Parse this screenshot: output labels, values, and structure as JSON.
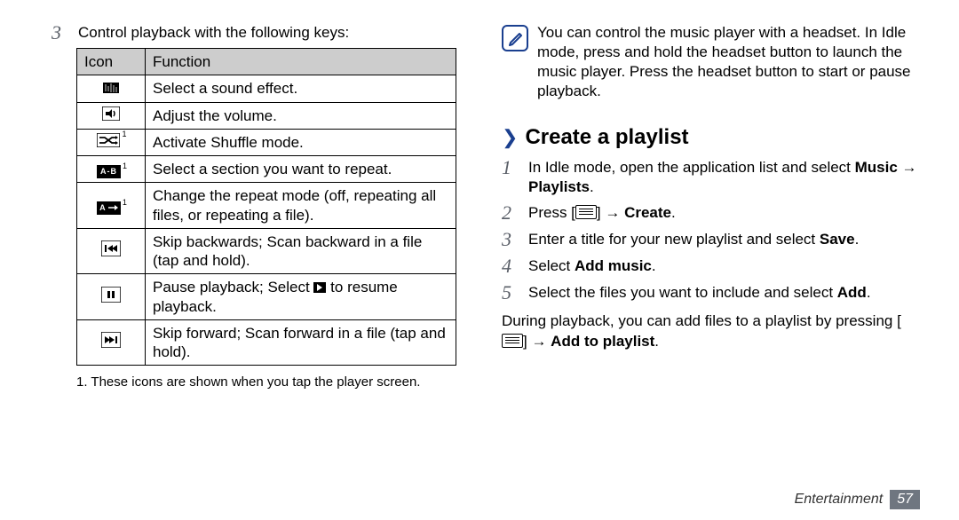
{
  "left": {
    "step3_number": "3",
    "step3_text": "Control playback with the following keys:",
    "table": {
      "headers": {
        "icon": "Icon",
        "function": "Function"
      },
      "rows": [
        {
          "icon_name": "sound-effect-icon",
          "sup": "",
          "function": "Select a sound effect."
        },
        {
          "icon_name": "volume-icon",
          "sup": "",
          "function": "Adjust the volume."
        },
        {
          "icon_name": "shuffle-icon",
          "sup": "1",
          "function": "Activate Shuffle mode."
        },
        {
          "icon_name": "ab-repeat-icon",
          "sup": "1",
          "function": "Select a section you want to repeat."
        },
        {
          "icon_name": "repeat-icon",
          "sup": "1",
          "function": "Change the repeat mode (off, repeating all files, or repeating a file)."
        },
        {
          "icon_name": "skip-back-icon",
          "sup": "",
          "function": "Skip backwards; Scan backward in a file (tap and hold)."
        },
        {
          "icon_name": "pause-icon",
          "sup": "",
          "function_pre": "Pause playback; Select ",
          "function_post": " to resume playback."
        },
        {
          "icon_name": "skip-fwd-icon",
          "sup": "",
          "function": "Skip forward; Scan forward in a file (tap and hold)."
        }
      ]
    },
    "footnote": "1. These icons are shown when you tap the player screen."
  },
  "right": {
    "note": "You can control the music player with a headset. In Idle mode, press and hold the headset button to launch the music player. Press the headset button to start or pause playback.",
    "heading": "Create a playlist",
    "steps": {
      "s1_num": "1",
      "s1_a": "In Idle mode, open the application list and select ",
      "s1_b": "Music → Playlists",
      "s1_c": ".",
      "s2_num": "2",
      "s2_a": "Press [",
      "s2_b": "] → ",
      "s2_c": "Create",
      "s2_d": ".",
      "s3_num": "3",
      "s3_a": "Enter a title for your new playlist and select ",
      "s3_b": "Save",
      "s3_c": ".",
      "s4_num": "4",
      "s4_a": "Select ",
      "s4_b": "Add music",
      "s4_c": ".",
      "s5_num": "5",
      "s5_a": "Select the files you want to include and select ",
      "s5_b": "Add",
      "s5_c": "."
    },
    "during_a": "During playback, you can add files to a playlist by pressing [",
    "during_b": "] → ",
    "during_c": "Add to playlist",
    "during_d": "."
  },
  "footer": {
    "section": "Entertainment",
    "page": "57"
  },
  "icon_labels": {
    "ab": "A-B",
    "a": "A"
  }
}
